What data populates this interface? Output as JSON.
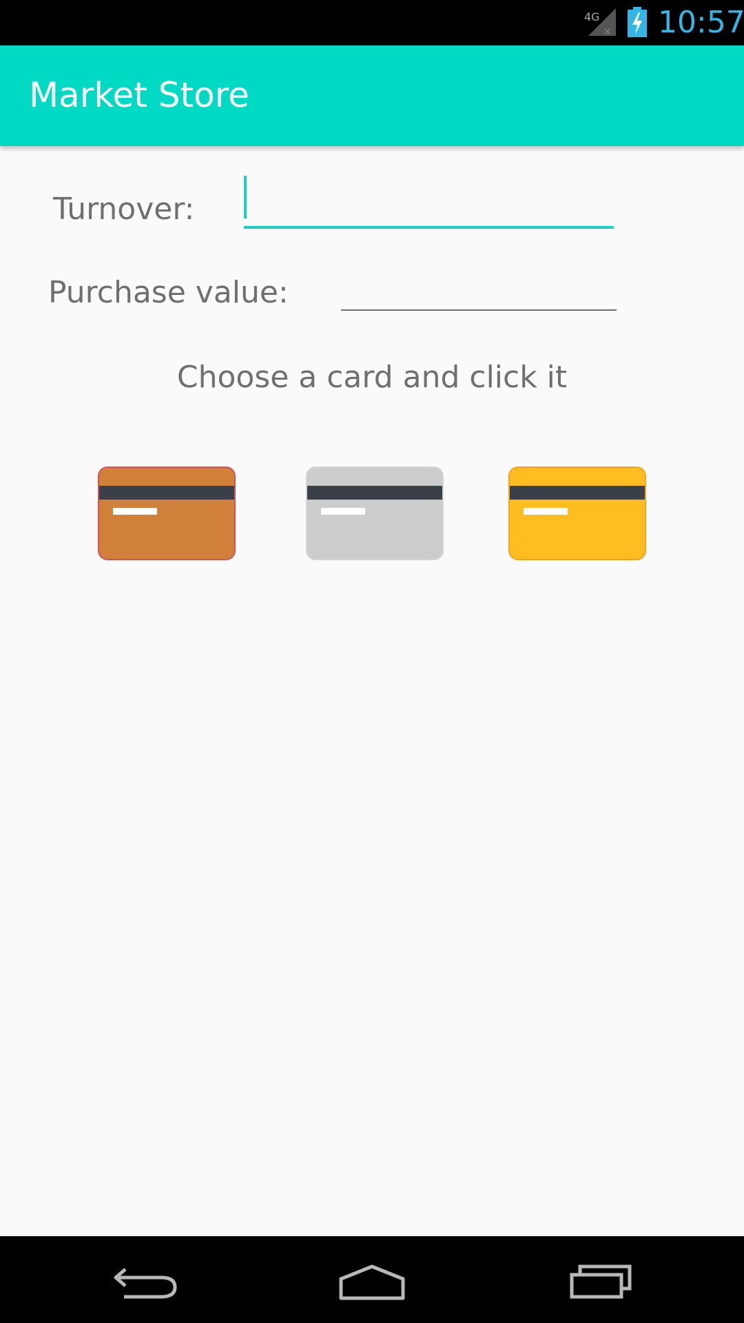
{
  "status_bar": {
    "time": "10:57",
    "network_label": "4G",
    "icons": [
      "signal-icon",
      "battery-icon"
    ],
    "time_color": "#33b5e5"
  },
  "app_bar": {
    "title": "Market Store",
    "color": "#00d9c4"
  },
  "form": {
    "turnover": {
      "label": "Turnover:",
      "value": "",
      "focused": true
    },
    "purchase_value": {
      "label": "Purchase value:",
      "value": ""
    },
    "hint": "Choose a card and click it"
  },
  "cards": [
    {
      "name": "bronze-card",
      "color": "#d1803a"
    },
    {
      "name": "silver-card",
      "color": "#cccccc"
    },
    {
      "name": "gold-card",
      "color": "#ffbd22"
    }
  ],
  "nav_bar": {
    "buttons": [
      "back-icon",
      "home-icon",
      "recents-icon"
    ]
  }
}
